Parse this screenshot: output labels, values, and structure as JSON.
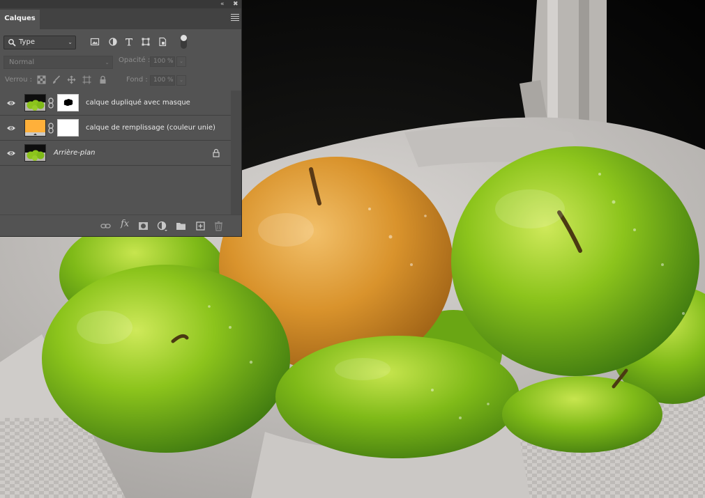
{
  "panel": {
    "tab_label": "Calques",
    "collapse_glyph": "«",
    "close_glyph": "✖",
    "filter_select_value": "Type",
    "blend_mode_value": "Normal",
    "opacity_label": "Opacité :",
    "opacity_value": "100 %",
    "lock_label": "Verrou :",
    "fill_label": "Fond :",
    "fill_value": "100 %"
  },
  "layers": [
    {
      "name": "calque dupliqué avec masque",
      "visible": true,
      "thumb": "apples-photo",
      "mask": "white-with-black-blob"
    },
    {
      "name": "calque de remplissage (couleur unie)",
      "visible": true,
      "thumb": "solid-fill",
      "fill_color": "#FFB03A",
      "mask": "white"
    },
    {
      "name": "Arrière-plan",
      "visible": true,
      "thumb": "apples-photo",
      "locked": true,
      "italic": true
    }
  ],
  "colors": {
    "panel_bg": "#535353",
    "tab_bar_bg": "#424242",
    "fill_layer_color": "#FFB03A",
    "apple_green": "#8cc41c",
    "apple_orange": "#d9932c"
  },
  "icons": [
    "search-icon",
    "image-filter-icon",
    "adjustment-filter-icon",
    "type-filter-icon",
    "shape-filter-icon",
    "smart-object-filter-icon",
    "link-layers-icon",
    "layer-style-icon",
    "add-mask-icon",
    "new-adjustment-icon",
    "new-group-icon",
    "new-layer-icon",
    "delete-icon",
    "eye-icon",
    "lock-icon"
  ]
}
